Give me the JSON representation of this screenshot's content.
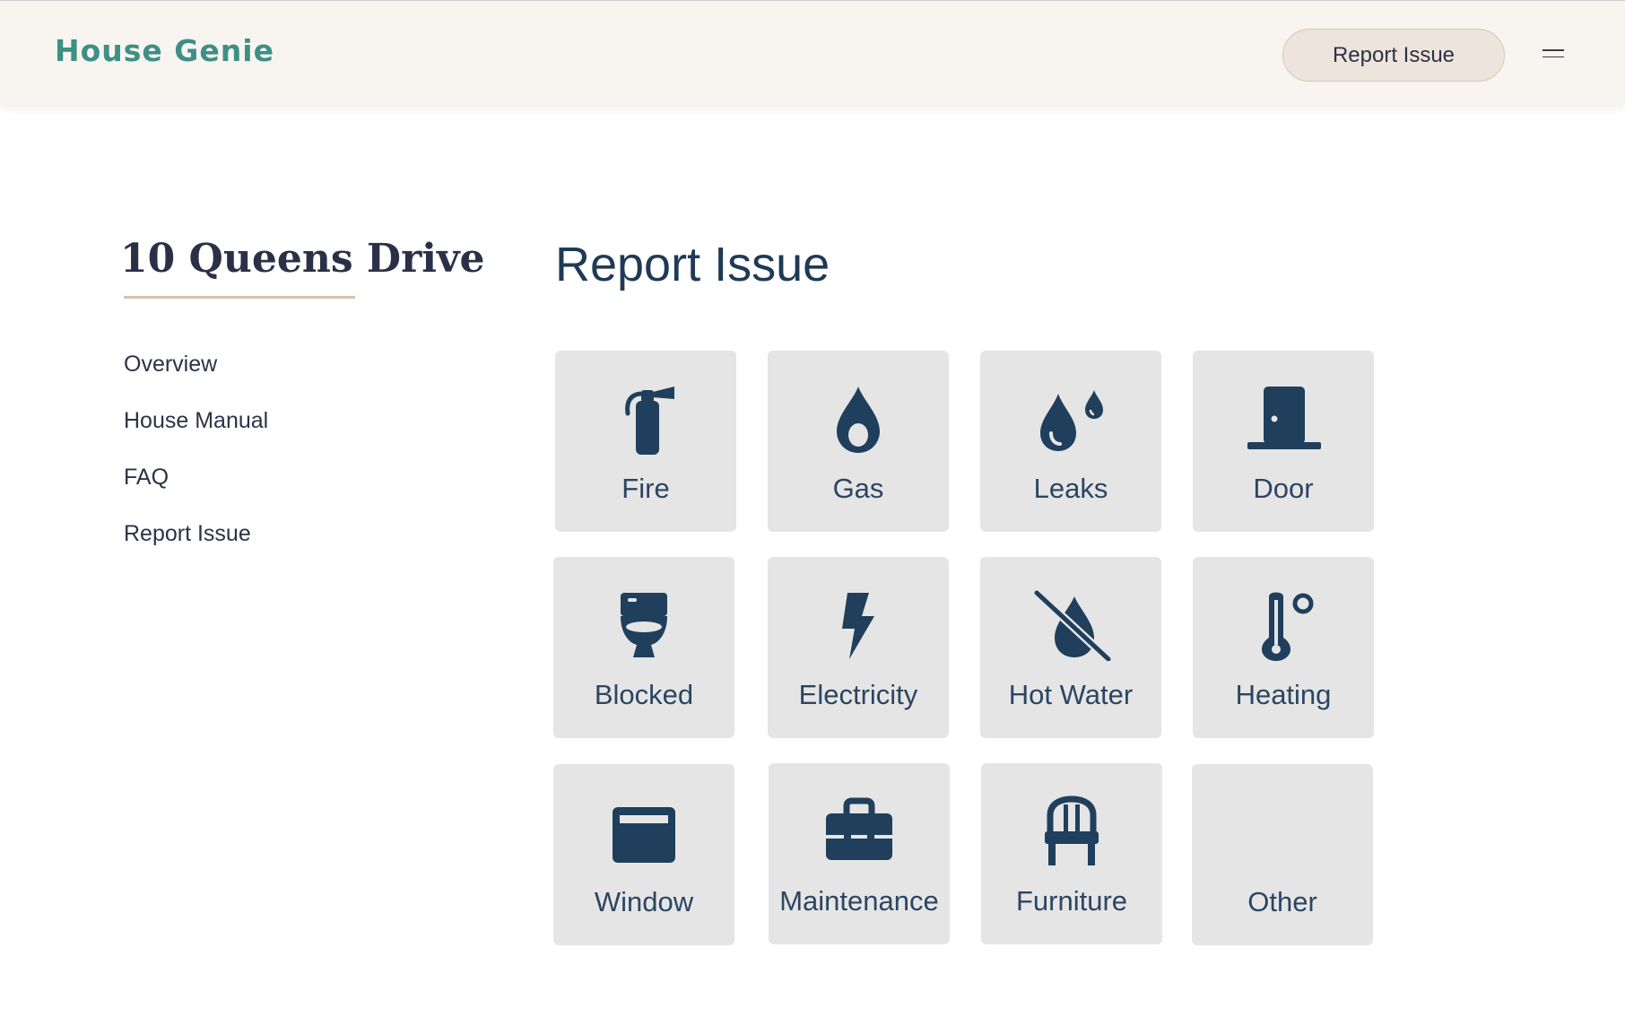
{
  "header": {
    "brand": "House Genie",
    "report_button_label": "Report Issue",
    "menu_icon": "hamburger-menu-icon"
  },
  "sidebar": {
    "property_title": "10 Queens Drive",
    "items": [
      {
        "label": "Overview"
      },
      {
        "label": "House Manual"
      },
      {
        "label": "FAQ"
      },
      {
        "label": "Report Issue"
      }
    ]
  },
  "main": {
    "title": "Report Issue",
    "tiles": [
      {
        "label": "Fire",
        "icon": "fire-extinguisher-icon"
      },
      {
        "label": "Gas",
        "icon": "gas-flame-drop-icon"
      },
      {
        "label": "Leaks",
        "icon": "water-drops-icon"
      },
      {
        "label": "Door",
        "icon": "door-icon"
      },
      {
        "label": "Blocked",
        "icon": "toilet-icon"
      },
      {
        "label": "Electricity",
        "icon": "lightning-bolt-icon"
      },
      {
        "label": "Hot Water",
        "icon": "no-water-icon"
      },
      {
        "label": "Heating",
        "icon": "thermometer-degree-icon"
      },
      {
        "label": "Window",
        "icon": "window-icon"
      },
      {
        "label": "Maintenance",
        "icon": "toolbox-icon"
      },
      {
        "label": "Furniture",
        "icon": "chair-icon"
      },
      {
        "label": "Other",
        "icon": ""
      }
    ]
  },
  "colors": {
    "brand": "#3e8f85",
    "icon": "#1f3f5c",
    "tile_bg": "#e5e5e5",
    "header_bg": "#f8f5f1",
    "accent_underline": "#d8c2ad"
  }
}
